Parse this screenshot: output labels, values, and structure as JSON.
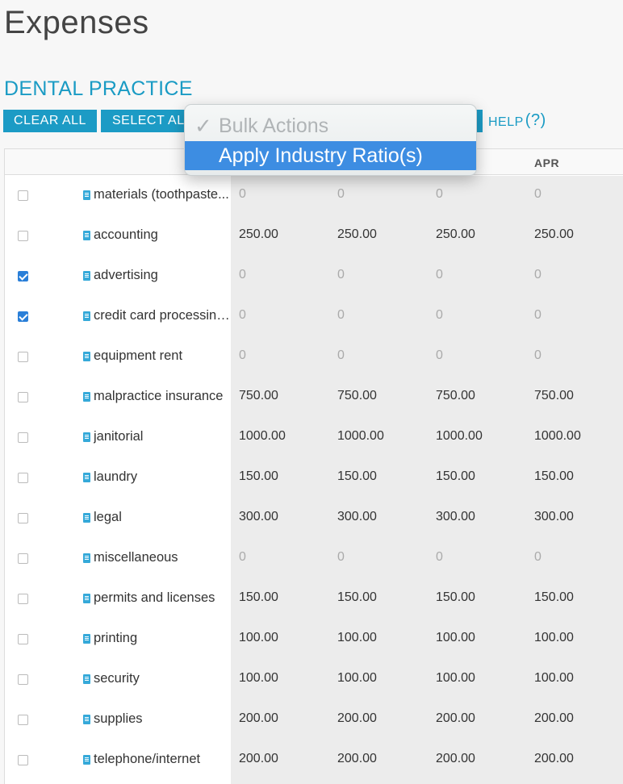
{
  "page": {
    "title": "Expenses"
  },
  "section": {
    "title": "DENTAL PRACTICE"
  },
  "toolbar": {
    "clear_all_label": "CLEAR ALL",
    "select_all_label": "SELECT ALL",
    "help_label": "HELP",
    "help_symbol": "(?)"
  },
  "dropdown": {
    "options": [
      {
        "label": "Bulk Actions",
        "selected": true,
        "icon": "checkmark-icon"
      },
      {
        "label": "Apply Industry Ratio(s)",
        "highlighted": true
      }
    ]
  },
  "table": {
    "visible_headers": [
      "APR"
    ],
    "rows": [
      {
        "label": "materials (toothpaste...",
        "checked": false,
        "values": [
          "0",
          "0",
          "0",
          "0"
        ]
      },
      {
        "label": "accounting",
        "checked": false,
        "values": [
          "250.00",
          "250.00",
          "250.00",
          "250.00"
        ]
      },
      {
        "label": "advertising",
        "checked": true,
        "values": [
          "0",
          "0",
          "0",
          "0"
        ]
      },
      {
        "label": "credit card processing...",
        "checked": true,
        "values": [
          "0",
          "0",
          "0",
          "0"
        ]
      },
      {
        "label": "equipment rent",
        "checked": false,
        "values": [
          "0",
          "0",
          "0",
          "0"
        ]
      },
      {
        "label": "malpractice insurance",
        "checked": false,
        "values": [
          "750.00",
          "750.00",
          "750.00",
          "750.00"
        ]
      },
      {
        "label": "janitorial",
        "checked": false,
        "values": [
          "1000.00",
          "1000.00",
          "1000.00",
          "1000.00"
        ]
      },
      {
        "label": "laundry",
        "checked": false,
        "values": [
          "150.00",
          "150.00",
          "150.00",
          "150.00"
        ]
      },
      {
        "label": "legal",
        "checked": false,
        "values": [
          "300.00",
          "300.00",
          "300.00",
          "300.00"
        ]
      },
      {
        "label": "miscellaneous",
        "checked": false,
        "values": [
          "0",
          "0",
          "0",
          "0"
        ]
      },
      {
        "label": "permits and licenses",
        "checked": false,
        "values": [
          "150.00",
          "150.00",
          "150.00",
          "150.00"
        ]
      },
      {
        "label": "printing",
        "checked": false,
        "values": [
          "100.00",
          "100.00",
          "100.00",
          "100.00"
        ]
      },
      {
        "label": "security",
        "checked": false,
        "values": [
          "100.00",
          "100.00",
          "100.00",
          "100.00"
        ]
      },
      {
        "label": "supplies",
        "checked": false,
        "values": [
          "200.00",
          "200.00",
          "200.00",
          "200.00"
        ]
      },
      {
        "label": "telephone/internet",
        "checked": false,
        "values": [
          "200.00",
          "200.00",
          "200.00",
          "200.00"
        ]
      }
    ]
  },
  "colors": {
    "accent": "#1c9bc5",
    "dropdown_highlight": "#3d8de2",
    "checkbox_checked": "#2a7fd8",
    "value_column_bg": "#ececec"
  }
}
